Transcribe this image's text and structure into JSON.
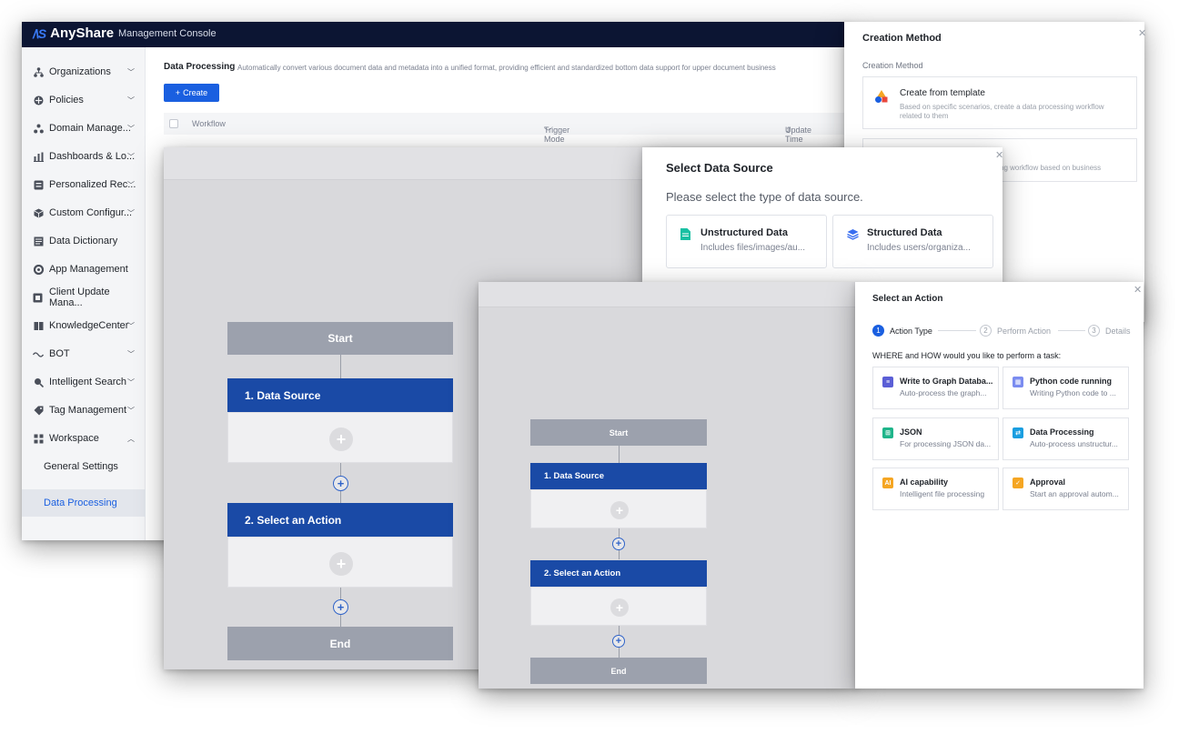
{
  "console": {
    "brand": "AnyShare",
    "subtitle": "Management Console",
    "nav": [
      {
        "label": "Organizations",
        "chevron": "﹀",
        "icon": "org-icon"
      },
      {
        "label": "Policies",
        "chevron": "﹀",
        "icon": "policy-icon"
      },
      {
        "label": "Domain Manage...",
        "chevron": "﹀",
        "icon": "domain-icon"
      },
      {
        "label": "Dashboards & Lo...",
        "chevron": "﹀",
        "icon": "dashboard-icon"
      },
      {
        "label": "Personalized Rec...",
        "chevron": "﹀",
        "icon": "recommend-icon"
      },
      {
        "label": "Custom Configur...",
        "chevron": "﹀",
        "icon": "config-icon"
      },
      {
        "label": "Data Dictionary",
        "chevron": "",
        "icon": "dictionary-icon"
      },
      {
        "label": "App Management",
        "chevron": "",
        "icon": "app-icon"
      },
      {
        "label": "Client Update Mana...",
        "chevron": "",
        "icon": "client-update-icon"
      },
      {
        "label": "KnowledgeCenter",
        "chevron": "﹀",
        "icon": "knowledge-icon"
      },
      {
        "label": "BOT",
        "chevron": "﹀",
        "icon": "bot-icon"
      },
      {
        "label": "Intelligent Search",
        "chevron": "﹀",
        "icon": "search-icon"
      },
      {
        "label": "Tag Management",
        "chevron": "﹀",
        "icon": "tag-icon"
      },
      {
        "label": "Workspace",
        "chevron": "︿",
        "icon": "workspace-icon"
      }
    ],
    "nav_sub": [
      {
        "label": "General Settings"
      },
      {
        "label": "Data Processing"
      }
    ],
    "page_title": "Data Processing",
    "page_desc": "Automatically convert various document data and metadata into a unified format, providing efficient and standardized bottom data support for upper document business",
    "create_label": "Create",
    "table": {
      "col_workflow": "Workflow",
      "col_trigger": "Trigger Mode",
      "col_update": "Update Time"
    }
  },
  "workflow": {
    "start": "Start",
    "step1": "1. Data Source",
    "step2": "2. Select an Action",
    "end": "End"
  },
  "creation_method": {
    "title": "Creation Method",
    "label": "Creation Method",
    "option1_title": "Create from template",
    "option1_desc": "Based on specific scenarios, create a data processing workflow related to them",
    "option2_desc_fragment": "ng workflow based on business"
  },
  "data_source": {
    "title": "Select Data Source",
    "subtitle": "Please select the type of data source.",
    "options": [
      {
        "title": "Unstructured Data",
        "desc": "Includes files/images/au..."
      },
      {
        "title": "Structured Data",
        "desc": "Includes users/organiza..."
      }
    ]
  },
  "select_action": {
    "title": "Select an Action",
    "steps": [
      {
        "num": "1",
        "label": "Action Type"
      },
      {
        "num": "2",
        "label": "Perform Action"
      },
      {
        "num": "3",
        "label": "Details"
      }
    ],
    "question": "WHERE and HOW would you like to perform a task:",
    "actions": [
      {
        "title": "Write to Graph Databa...",
        "desc": "Auto-process the graph...",
        "color": "#5b5fd6"
      },
      {
        "title": "Python code running",
        "desc": "Writing Python code to ...",
        "color": "#7b8cf0"
      },
      {
        "title": "JSON",
        "desc": "For processing JSON da...",
        "color": "#1fb58a"
      },
      {
        "title": "Data Processing",
        "desc": "Auto-process unstructur...",
        "color": "#1a9ee0"
      },
      {
        "title": "AI capability",
        "desc": "Intelligent file processing",
        "color": "#f5a623"
      },
      {
        "title": "Approval",
        "desc": "Start an approval autom...",
        "color": "#f5a623"
      }
    ]
  },
  "colors": {
    "accent": "#1a5fe0",
    "topbar": "#0c1533",
    "flow_blue": "#1a4aa6"
  }
}
